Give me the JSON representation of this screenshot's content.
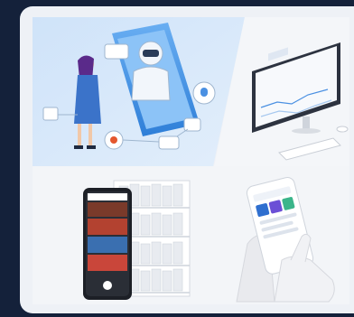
{
  "card": {
    "panels": [
      {
        "name": "ai-assistant-illustration",
        "icon": "robot-assistant-icon"
      },
      {
        "name": "desktop-dashboard-illustration",
        "icon": "desktop-monitor-icon"
      },
      {
        "name": "retail-shelf-app-illustration",
        "icon": "phone-shelf-scan-icon"
      },
      {
        "name": "mobile-app-hand-illustration",
        "icon": "hand-phone-icon"
      }
    ]
  },
  "colors": {
    "background": "#14213a",
    "card": "#eef1f6",
    "accent_blue": "#4a90e2",
    "light_blue": "#d6e8fa"
  }
}
